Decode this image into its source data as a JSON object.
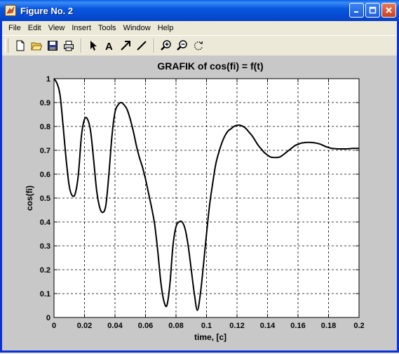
{
  "window": {
    "title": "Figure No. 2"
  },
  "menu": [
    "File",
    "Edit",
    "View",
    "Insert",
    "Tools",
    "Window",
    "Help"
  ],
  "toolbar": {
    "icons": [
      "new-file-icon",
      "open-folder-icon",
      "save-icon",
      "print-icon",
      "arrow-select-icon",
      "text-insert-icon",
      "arrow-insert-icon",
      "line-insert-icon",
      "zoom-in-icon",
      "zoom-out-icon",
      "rotate-icon"
    ]
  },
  "chart_data": {
    "type": "line",
    "title": "GRAFIK of  cos(fi) = f(t)",
    "xlabel": "time, [c]",
    "ylabel": "cos(fi)",
    "xlim": [
      0,
      0.2
    ],
    "ylim": [
      0,
      1
    ],
    "x_ticks": [
      "0",
      "0.02",
      "0.04",
      "0.06",
      "0.08",
      "0.1",
      "0.12",
      "0.14",
      "0.16",
      "0.18",
      "0.2"
    ],
    "y_ticks": [
      "0",
      "0.1",
      "0.2",
      "0.3",
      "0.4",
      "0.5",
      "0.6",
      "0.7",
      "0.8",
      "0.9",
      "1"
    ],
    "grid": true,
    "series": [
      {
        "color": "#000000",
        "x": [
          0,
          0.002,
          0.004,
          0.006,
          0.008,
          0.01,
          0.012,
          0.014,
          0.016,
          0.018,
          0.02,
          0.022,
          0.024,
          0.026,
          0.028,
          0.03,
          0.032,
          0.034,
          0.036,
          0.038,
          0.04,
          0.042,
          0.044,
          0.046,
          0.048,
          0.05,
          0.052,
          0.054,
          0.056,
          0.058,
          0.06,
          0.062,
          0.064,
          0.066,
          0.068,
          0.07,
          0.072,
          0.074,
          0.076,
          0.078,
          0.08,
          0.082,
          0.084,
          0.086,
          0.088,
          0.09,
          0.092,
          0.094,
          0.096,
          0.098,
          0.1,
          0.102,
          0.104,
          0.106,
          0.108,
          0.11,
          0.112,
          0.114,
          0.116,
          0.118,
          0.12,
          0.122,
          0.124,
          0.126,
          0.128,
          0.13,
          0.132,
          0.134,
          0.136,
          0.138,
          0.14,
          0.142,
          0.144,
          0.146,
          0.148,
          0.15,
          0.152,
          0.154,
          0.156,
          0.158,
          0.16,
          0.162,
          0.164,
          0.166,
          0.168,
          0.17,
          0.172,
          0.174,
          0.176,
          0.178,
          0.18,
          0.182,
          0.184,
          0.186,
          0.188,
          0.19,
          0.192,
          0.194,
          0.196,
          0.198,
          0.2
        ],
        "y": [
          1.0,
          0.98,
          0.93,
          0.8,
          0.66,
          0.55,
          0.51,
          0.52,
          0.6,
          0.76,
          0.83,
          0.83,
          0.78,
          0.66,
          0.53,
          0.46,
          0.44,
          0.47,
          0.6,
          0.76,
          0.86,
          0.89,
          0.9,
          0.89,
          0.87,
          0.83,
          0.78,
          0.72,
          0.67,
          0.63,
          0.58,
          0.52,
          0.46,
          0.39,
          0.28,
          0.15,
          0.07,
          0.05,
          0.14,
          0.3,
          0.38,
          0.4,
          0.4,
          0.37,
          0.3,
          0.2,
          0.1,
          0.03,
          0.1,
          0.22,
          0.35,
          0.47,
          0.56,
          0.64,
          0.69,
          0.73,
          0.76,
          0.78,
          0.79,
          0.8,
          0.805,
          0.805,
          0.8,
          0.79,
          0.775,
          0.76,
          0.74,
          0.72,
          0.705,
          0.69,
          0.68,
          0.672,
          0.67,
          0.67,
          0.672,
          0.68,
          0.69,
          0.7,
          0.71,
          0.72,
          0.725,
          0.73,
          0.732,
          0.733,
          0.733,
          0.732,
          0.73,
          0.727,
          0.722,
          0.716,
          0.712,
          0.708,
          0.707,
          0.706,
          0.706,
          0.706,
          0.706,
          0.707,
          0.708,
          0.708,
          0.708
        ]
      }
    ]
  }
}
